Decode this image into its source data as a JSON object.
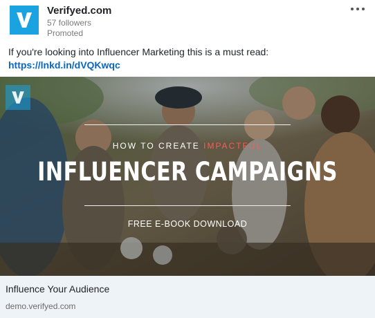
{
  "post": {
    "company_name": "Verifyed.com",
    "followers": "57 followers",
    "promoted": "Promoted",
    "text": "If you're looking into Influencer Marketing this is a must read:",
    "link": "https://lnkd.in/dVQKwqc",
    "menu_icon": "more-horizontal-icon",
    "logo_icon": "verifyed-v-logo",
    "brand_color": "#1aa3e0",
    "link_color": "#0a66c2"
  },
  "banner": {
    "how_prefix": "HOW TO CREATE ",
    "how_highlight": "IMPACTFUL",
    "highlight_color": "#ff5a5a",
    "title": "INFLUENCER CAMPAIGNS",
    "subtitle": "FREE E-BOOK DOWNLOAD"
  },
  "link_card": {
    "title": "Influence Your Audience",
    "domain": "demo.verifyed.com"
  }
}
